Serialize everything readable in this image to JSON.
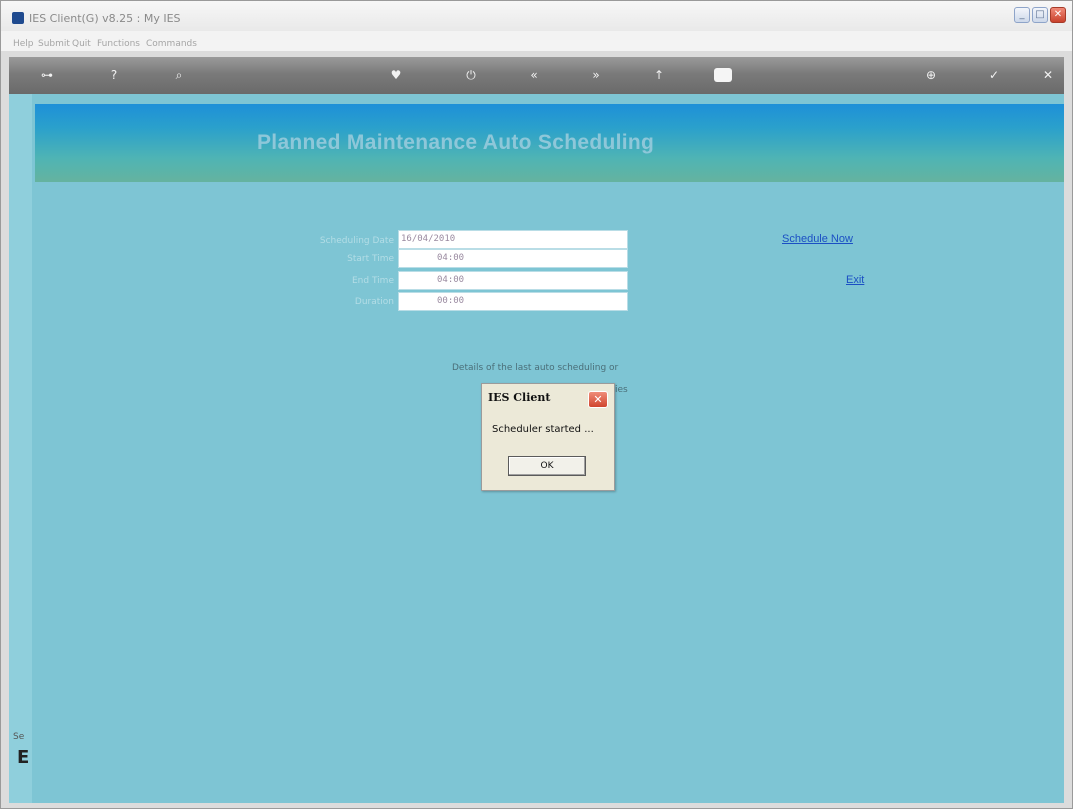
{
  "window": {
    "title": "IES Client(G) v8.25 : My IES",
    "minimize_label": "_",
    "maximize_label": "□",
    "close_label": "✕"
  },
  "menu": {
    "items": [
      {
        "label": "Help"
      },
      {
        "label": "Submit"
      },
      {
        "label": "Quit"
      },
      {
        "label": "Functions"
      },
      {
        "label": "Commands"
      }
    ]
  },
  "toolbar": {
    "icons": [
      {
        "name": "key-icon",
        "glyph": "⊶"
      },
      {
        "name": "help-icon",
        "glyph": "?"
      },
      {
        "name": "search-icon",
        "glyph": "⌕"
      },
      {
        "name": "heart-icon",
        "glyph": "♥"
      },
      {
        "name": "power-icon",
        "glyph": "⏻"
      },
      {
        "name": "rewind-icon",
        "glyph": "«"
      },
      {
        "name": "forward-icon",
        "glyph": "»"
      },
      {
        "name": "upload-icon",
        "glyph": "↑"
      },
      {
        "name": "page-icon",
        "glyph": ""
      },
      {
        "name": "save-icon",
        "glyph": "⊕"
      },
      {
        "name": "check-icon",
        "glyph": "✓"
      },
      {
        "name": "close-icon",
        "glyph": "✕"
      }
    ]
  },
  "sidebar": {
    "text": "Se",
    "glyph": "E"
  },
  "page": {
    "title": "Planned Maintenance Auto Scheduling"
  },
  "form": {
    "fields": [
      {
        "label": "Scheduling Date",
        "value": "16/04/2010"
      },
      {
        "label": "Start Time",
        "value": "04:00"
      },
      {
        "label": "End Time",
        "value": "04:00"
      },
      {
        "label": "Duration",
        "value": "00:00"
      }
    ]
  },
  "links": {
    "schedule_now": "Schedule Now",
    "exit": "Exit"
  },
  "details": {
    "line1": "Details of the last auto scheduling or",
    "line2_suffix": "ies"
  },
  "dialog": {
    "title": "IES Client",
    "close_label": "✕",
    "message": "Scheduler started ...",
    "ok_label": "OK"
  },
  "colors": {
    "header_top": "#1e90d8",
    "header_bottom": "#65b39f",
    "background": "#7ec5d4",
    "link": "#1b4fc4",
    "toolbar": "#7a7a7a"
  }
}
